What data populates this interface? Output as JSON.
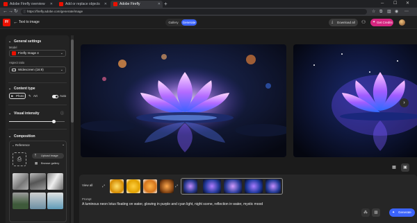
{
  "browser": {
    "tabs": [
      {
        "label": "Adobe Firefly overview",
        "active": false
      },
      {
        "label": "Add or replace objects",
        "active": false
      },
      {
        "label": "Adobe Firefly",
        "active": true
      }
    ],
    "url": "https://firefly.adobe.com/generate/image"
  },
  "header": {
    "logo": "Ff",
    "title": "Text to image",
    "segments": [
      "Gallery",
      "Generate"
    ],
    "active_segment": "Generate",
    "download_all": "Download all",
    "get_credits": "Get Credits"
  },
  "sidebar": {
    "general": {
      "title": "General settings",
      "model_label": "Model",
      "model_value": "Firefly Image 4",
      "aspect_label": "Aspect ratio",
      "aspect_value": "Widescreen (16:9)"
    },
    "content_type": {
      "title": "Content type",
      "options": [
        "Photo",
        "Art"
      ],
      "selected": "Photo",
      "auto_label": "Auto",
      "auto_on": true
    },
    "visual_intensity": {
      "title": "Visual intensity",
      "level": 0.8
    },
    "composition": {
      "title": "Composition",
      "reference_label": "Reference",
      "upload_image": "Upload image",
      "browse_gallery": "Browse gallery"
    }
  },
  "main": {
    "view_all": "View all",
    "prompt_label": "Prompt",
    "prompt_text": "A luminous neon lotus floating on water, glowing in purple and cyan light, night scene, reflection in water, mystic mood",
    "generate_label": "Generate"
  },
  "colors": {
    "accent": "#3b63fb",
    "credits": "#d5257f",
    "brand": "#eb1000"
  }
}
